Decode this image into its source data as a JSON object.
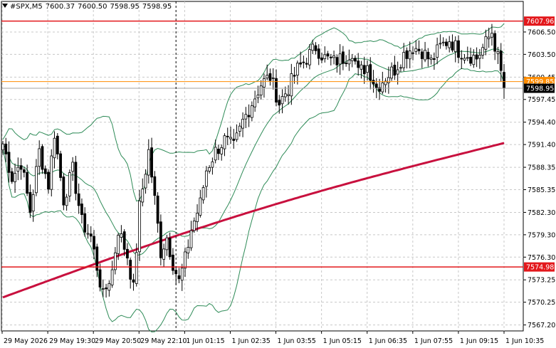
{
  "header": {
    "symbol": "#SPX,M5",
    "open": "7600.37",
    "high": "7600.50",
    "low": "7598.95",
    "close": "7598.95"
  },
  "colors": {
    "background": "#ffffff",
    "grid": "#c8c8c8",
    "candle": "#000000",
    "bollinger": "#2e8b57",
    "ma": "#c8103e",
    "hline": "#e3181c",
    "bid_line": "#ff8c00",
    "last_line": "#a0a0a0",
    "tag_red": "#e3181c",
    "tag_orange": "#ff8c00",
    "tag_black": "#000000"
  },
  "chart_data": {
    "type": "candlestick",
    "title": "#SPX,M5",
    "ylim": [
      7566.4,
      7610.6
    ],
    "y_ticks": [
      "7606.50",
      "7603.50",
      "7600.45",
      "7597.45",
      "7594.40",
      "7591.40",
      "7588.35",
      "7585.35",
      "7582.30",
      "7579.30",
      "7576.30",
      "7573.25",
      "7570.25",
      "7567.20"
    ],
    "x_ticks": [
      "29 May 2026",
      "29 May 19:30",
      "29 May 20:50",
      "29 May 22:10",
      "1 Jun 01:15",
      "1 Jun 02:35",
      "1 Jun 03:55",
      "1 Jun 05:15",
      "1 Jun 06:35",
      "1 Jun 07:55",
      "1 Jun 09:15",
      "1 Jun 10:35"
    ],
    "price_tags": [
      {
        "label": "7607.96",
        "value": 7607.96,
        "kind": "red"
      },
      {
        "label": "7599.85",
        "value": 7599.85,
        "kind": "orange"
      },
      {
        "label": "7598.95",
        "value": 7598.95,
        "kind": "black"
      },
      {
        "label": "7574.98",
        "value": 7574.98,
        "kind": "red"
      }
    ],
    "horizontal_lines": [
      7607.96,
      7574.98
    ],
    "bid_line": 7599.85,
    "last_price": 7598.95,
    "vertical_marker_index": 57,
    "candle_count": 166,
    "ma": {
      "start": 7570.9,
      "end": 7591.6
    },
    "close_anchors": [
      [
        0,
        7591.5
      ],
      [
        3,
        7587.0
      ],
      [
        6,
        7589.0
      ],
      [
        9,
        7582.5
      ],
      [
        12,
        7590.5
      ],
      [
        15,
        7586.0
      ],
      [
        17,
        7593.0
      ],
      [
        20,
        7584.0
      ],
      [
        23,
        7588.0
      ],
      [
        26,
        7581.0
      ],
      [
        29,
        7579.0
      ],
      [
        31,
        7575.0
      ],
      [
        33,
        7571.0
      ],
      [
        36,
        7574.5
      ],
      [
        38,
        7580.0
      ],
      [
        41,
        7576.5
      ],
      [
        43,
        7572.0
      ],
      [
        45,
        7583.0
      ],
      [
        48,
        7590.5
      ],
      [
        50,
        7584.0
      ],
      [
        52,
        7577.0
      ],
      [
        54,
        7579.0
      ],
      [
        56,
        7575.5
      ],
      [
        58,
        7573.0
      ],
      [
        60,
        7576.0
      ],
      [
        62,
        7580.0
      ],
      [
        65,
        7583.5
      ],
      [
        67,
        7588.0
      ],
      [
        70,
        7590.5
      ],
      [
        73,
        7592.0
      ],
      [
        76,
        7591.0
      ],
      [
        79,
        7594.5
      ],
      [
        82,
        7597.0
      ],
      [
        85,
        7599.5
      ],
      [
        88,
        7600.5
      ],
      [
        91,
        7597.0
      ],
      [
        94,
        7599.0
      ],
      [
        97,
        7601.5
      ],
      [
        100,
        7603.0
      ],
      [
        103,
        7604.5
      ],
      [
        106,
        7603.0
      ],
      [
        109,
        7602.5
      ],
      [
        112,
        7603.0
      ],
      [
        115,
        7604.0
      ],
      [
        117,
        7601.0
      ],
      [
        120,
        7602.0
      ],
      [
        123,
        7599.0
      ],
      [
        126,
        7600.5
      ],
      [
        129,
        7601.5
      ],
      [
        132,
        7603.5
      ],
      [
        135,
        7604.5
      ],
      [
        138,
        7604.0
      ],
      [
        141,
        7602.5
      ],
      [
        144,
        7604.5
      ],
      [
        147,
        7605.5
      ],
      [
        150,
        7604.0
      ],
      [
        153,
        7603.5
      ],
      [
        156,
        7603.0
      ],
      [
        159,
        7605.0
      ],
      [
        161,
        7606.5
      ],
      [
        163,
        7603.0
      ],
      [
        165,
        7598.95
      ]
    ]
  }
}
